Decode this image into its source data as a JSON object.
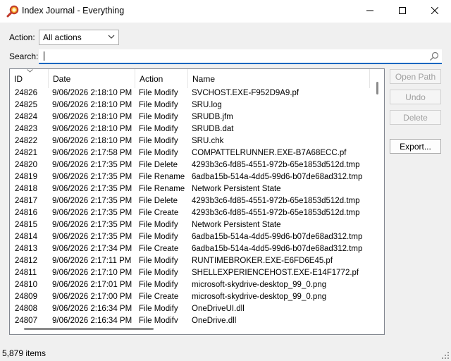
{
  "window": {
    "title": "Index Journal - Everything",
    "minimize_icon": "minimize-icon",
    "maximize_icon": "maximize-icon",
    "close_icon": "close-icon"
  },
  "filters": {
    "action_label": "Action:",
    "action_value": "All actions",
    "search_label": "Search:",
    "search_value": ""
  },
  "columns": {
    "id": "ID",
    "date": "Date",
    "action": "Action",
    "name": "Name"
  },
  "rows": [
    {
      "id": "24826",
      "date": "9/06/2026 2:18:10 PM",
      "action": "File Modify",
      "name": "SVCHOST.EXE-F952D9A9.pf"
    },
    {
      "id": "24825",
      "date": "9/06/2026 2:18:10 PM",
      "action": "File Modify",
      "name": "SRU.log"
    },
    {
      "id": "24824",
      "date": "9/06/2026 2:18:10 PM",
      "action": "File Modify",
      "name": "SRUDB.jfm"
    },
    {
      "id": "24823",
      "date": "9/06/2026 2:18:10 PM",
      "action": "File Modify",
      "name": "SRUDB.dat"
    },
    {
      "id": "24822",
      "date": "9/06/2026 2:18:10 PM",
      "action": "File Modify",
      "name": "SRU.chk"
    },
    {
      "id": "24821",
      "date": "9/06/2026 2:17:58 PM",
      "action": "File Modify",
      "name": "COMPATTELRUNNER.EXE-B7A68ECC.pf"
    },
    {
      "id": "24820",
      "date": "9/06/2026 2:17:35 PM",
      "action": "File Delete",
      "name": "4293b3c6-fd85-4551-972b-65e1853d512d.tmp"
    },
    {
      "id": "24819",
      "date": "9/06/2026 2:17:35 PM",
      "action": "File Rename",
      "name": "6adba15b-514a-4dd5-99d6-b07de68ad312.tmp"
    },
    {
      "id": "24818",
      "date": "9/06/2026 2:17:35 PM",
      "action": "File Rename",
      "name": "Network Persistent State"
    },
    {
      "id": "24817",
      "date": "9/06/2026 2:17:35 PM",
      "action": "File Delete",
      "name": "4293b3c6-fd85-4551-972b-65e1853d512d.tmp"
    },
    {
      "id": "24816",
      "date": "9/06/2026 2:17:35 PM",
      "action": "File Create",
      "name": "4293b3c6-fd85-4551-972b-65e1853d512d.tmp"
    },
    {
      "id": "24815",
      "date": "9/06/2026 2:17:35 PM",
      "action": "File Modify",
      "name": "Network Persistent State"
    },
    {
      "id": "24814",
      "date": "9/06/2026 2:17:35 PM",
      "action": "File Modify",
      "name": "6adba15b-514a-4dd5-99d6-b07de68ad312.tmp"
    },
    {
      "id": "24813",
      "date": "9/06/2026 2:17:34 PM",
      "action": "File Create",
      "name": "6adba15b-514a-4dd5-99d6-b07de68ad312.tmp"
    },
    {
      "id": "24812",
      "date": "9/06/2026 2:17:11 PM",
      "action": "File Modify",
      "name": "RUNTIMEBROKER.EXE-E6FD6E45.pf"
    },
    {
      "id": "24811",
      "date": "9/06/2026 2:17:10 PM",
      "action": "File Modify",
      "name": "SHELLEXPERIENCEHOST.EXE-E14F1772.pf"
    },
    {
      "id": "24810",
      "date": "9/06/2026 2:17:01 PM",
      "action": "File Modify",
      "name": "microsoft-skydrive-desktop_99_0.png"
    },
    {
      "id": "24809",
      "date": "9/06/2026 2:17:00 PM",
      "action": "File Create",
      "name": "microsoft-skydrive-desktop_99_0.png"
    },
    {
      "id": "24808",
      "date": "9/06/2026 2:16:34 PM",
      "action": "File Modify",
      "name": "OneDriveUI.dll"
    },
    {
      "id": "24807",
      "date": "9/06/2026 2:16:34 PM",
      "action": "File Modify",
      "name": "OneDrive.dll"
    }
  ],
  "buttons": {
    "open_path": "Open Path",
    "undo": "Undo",
    "delete": "Delete",
    "export": "Export..."
  },
  "status": {
    "count": "5,879 items"
  }
}
